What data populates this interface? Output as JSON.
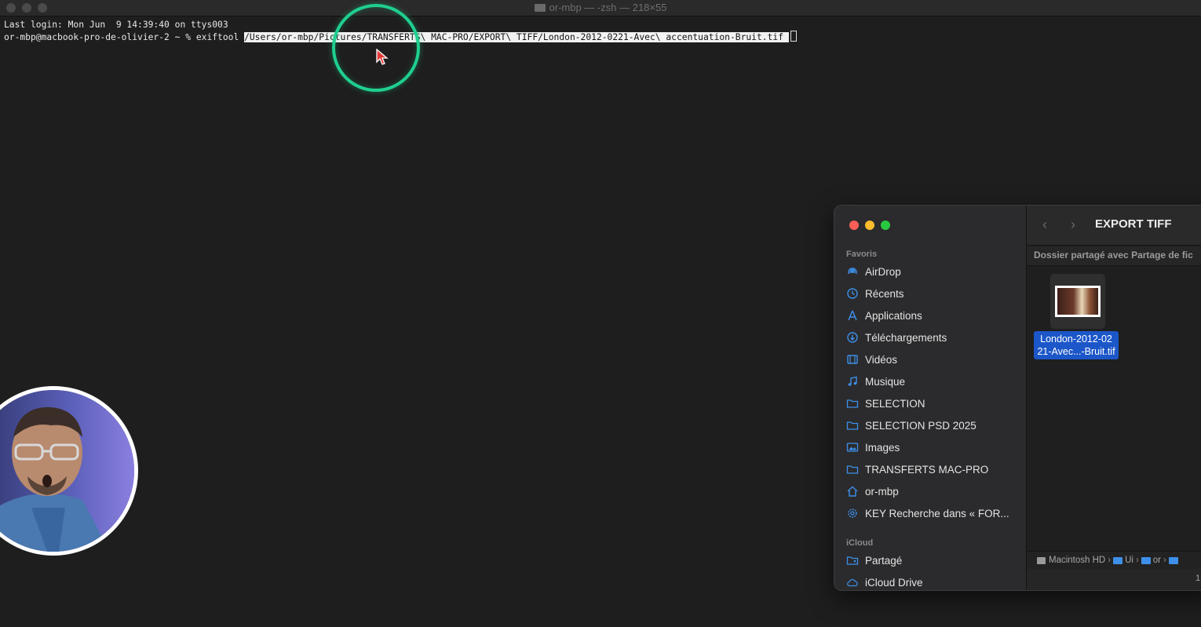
{
  "terminal": {
    "title": "or-mbp — -zsh — 218×55",
    "last_login": "Last login: Mon Jun  9 14:39:40 on ttys003",
    "prompt": "or-mbp@macbook-pro-de-olivier-2 ~ % exiftool ",
    "command_path": "/Users/or-mbp/Pictures/TRANSFERTS\\ MAC-PRO/EXPORT\\ TIFF/London-2012-0221-Avec\\ accentuation-Bruit.tif "
  },
  "colors": {
    "click_ring": "#1fcf8f",
    "finder_accent": "#3d8fe8",
    "file_selection": "#1c57c9"
  },
  "finder": {
    "sidebar": {
      "favorites_label": "Favoris",
      "favorites": [
        {
          "label": "AirDrop",
          "icon": "airdrop-icon"
        },
        {
          "label": "Récents",
          "icon": "clock-icon"
        },
        {
          "label": "Applications",
          "icon": "applications-icon"
        },
        {
          "label": "Téléchargements",
          "icon": "download-icon"
        },
        {
          "label": "Vidéos",
          "icon": "film-icon"
        },
        {
          "label": "Musique",
          "icon": "music-icon"
        },
        {
          "label": "SELECTION",
          "icon": "folder-icon"
        },
        {
          "label": "SELECTION PSD 2025",
          "icon": "folder-icon"
        },
        {
          "label": "Images",
          "icon": "photo-icon"
        },
        {
          "label": "TRANSFERTS MAC-PRO",
          "icon": "folder-icon"
        },
        {
          "label": "or-mbp",
          "icon": "home-icon"
        },
        {
          "label": "KEY Recherche dans « FOR...",
          "icon": "gear-icon"
        }
      ],
      "icloud_label": "iCloud",
      "icloud": [
        {
          "label": "Partagé",
          "icon": "shared-folder-icon"
        },
        {
          "label": "iCloud Drive",
          "icon": "cloud-icon"
        }
      ]
    },
    "folder_title": "EXPORT TIFF",
    "shared_banner": "Dossier partagé avec Partage de fic",
    "file": {
      "name_line1": "London-2012-02",
      "name_line2": "21-Avec...-Bruit.tif"
    },
    "path_bar": {
      "disk": "Macintosh HD",
      "seg1": "Ui",
      "seg2": "or"
    },
    "status_count": "1"
  }
}
